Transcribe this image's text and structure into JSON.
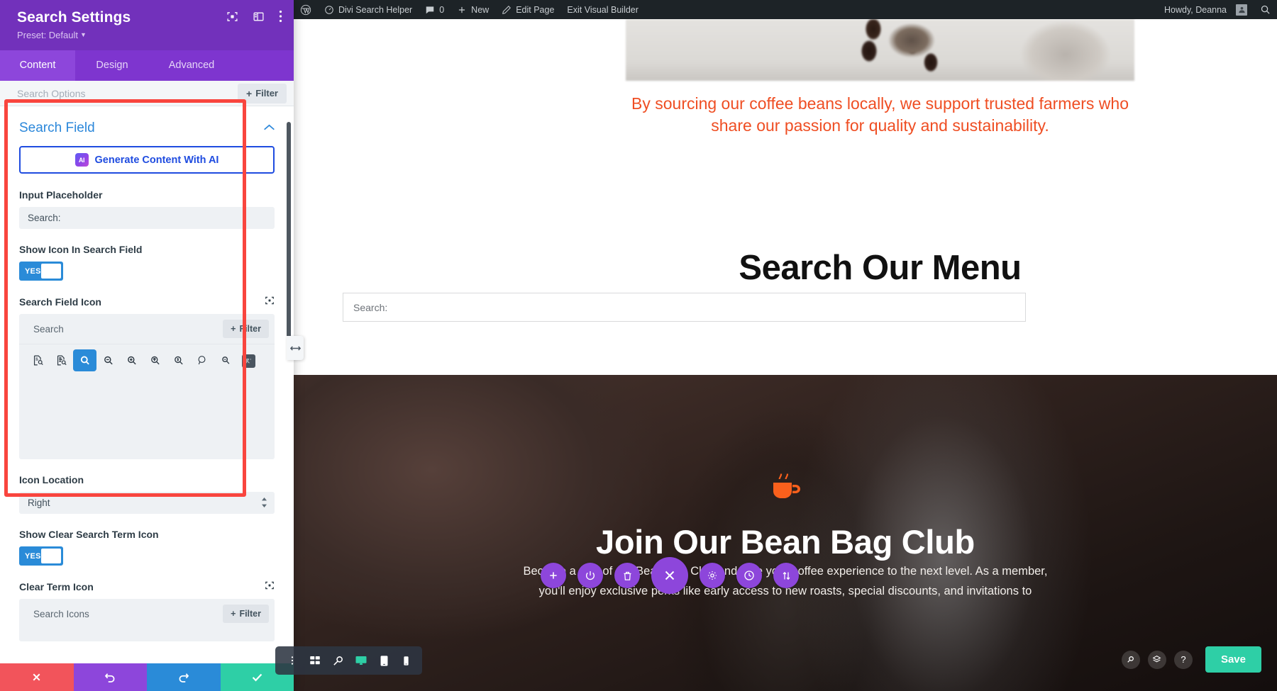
{
  "settings_panel": {
    "title": "Search Settings",
    "preset": "Preset: Default",
    "header_icons": [
      "responsive-preview-icon",
      "layout-columns-icon",
      "more-options-icon"
    ],
    "tabs": [
      {
        "label": "Content",
        "active": true
      },
      {
        "label": "Design",
        "active": false
      },
      {
        "label": "Advanced",
        "active": false
      }
    ],
    "subbar": {
      "search_label": "Search Options",
      "filter_label": "Filter"
    },
    "section": {
      "title": "Search Field",
      "collapse_icon": "chevron-up-icon",
      "ai_button_label": "Generate Content With AI",
      "ai_badge_text": "AI",
      "input_placeholder_label": "Input Placeholder",
      "input_placeholder_value": "Search:",
      "show_icon_label": "Show Icon In Search Field",
      "show_icon_toggle": "YES",
      "search_field_icon_label": "Search Field Icon",
      "icon_picker": {
        "search_placeholder": "Search",
        "filter_label": "Filter",
        "icons": [
          {
            "name": "document-search-icon",
            "selected": false
          },
          {
            "name": "file-search-icon",
            "selected": false
          },
          {
            "name": "magnifier-icon",
            "selected": true
          },
          {
            "name": "zoom-out-icon",
            "selected": false
          },
          {
            "name": "zoom-in-icon",
            "selected": false
          },
          {
            "name": "magnifier-location-icon",
            "selected": false
          },
          {
            "name": "magnifier-dollar-icon",
            "selected": false
          },
          {
            "name": "magnifier-outline-icon",
            "selected": false
          },
          {
            "name": "magnifier-small-icon",
            "selected": false
          },
          {
            "name": "raw-glyph-icon",
            "selected": false
          }
        ]
      },
      "icon_location_label": "Icon Location",
      "icon_location_value": "Right",
      "show_clear_label": "Show Clear Search Term Icon",
      "show_clear_toggle": "YES",
      "clear_term_icon_label": "Clear Term Icon",
      "clear_term_picker": {
        "search_placeholder": "Search Icons",
        "filter_label": "Filter"
      }
    },
    "footer": [
      {
        "name": "discard-button",
        "icon": "close-icon",
        "color": "#f2545b"
      },
      {
        "name": "undo-button",
        "icon": "undo-icon",
        "color": "#8d46db"
      },
      {
        "name": "redo-button",
        "icon": "redo-icon",
        "color": "#2a8bd8"
      },
      {
        "name": "apply-button",
        "icon": "check-icon",
        "color": "#2ecfa6"
      }
    ]
  },
  "admin_bar": {
    "items": [
      {
        "name": "wordpress-logo",
        "label": ""
      },
      {
        "name": "site-name",
        "label": "Divi Search Helper"
      },
      {
        "name": "comments",
        "label": "0"
      },
      {
        "name": "new-content",
        "label": "New"
      },
      {
        "name": "edit-page",
        "label": "Edit Page"
      },
      {
        "name": "exit-visual-builder",
        "label": "Exit Visual Builder"
      }
    ],
    "howdy": "Howdy, Deanna",
    "search_icon": "search-icon"
  },
  "preview": {
    "orange_copy": "By sourcing our coffee beans locally, we support trusted farmers who share our passion for quality and sustainability.",
    "menu_heading": "Search Our Menu",
    "search_placeholder": "Search:",
    "club_heading": "Join Our Bean Bag Club",
    "club_copy": "Become a part of our Bean Bag Club and take your coffee experience to the next level. As a member, you'll enjoy exclusive perks like early access to new roasts, special discounts, and invitations to",
    "cup_icon": "coffee-cup-icon"
  },
  "divi_toolbar": {
    "items": [
      {
        "name": "more-vertical-icon",
        "active": false
      },
      {
        "name": "wireframe-view-icon",
        "active": false
      },
      {
        "name": "zoom-out-view-icon",
        "active": false
      },
      {
        "name": "desktop-view-icon",
        "active": true
      },
      {
        "name": "tablet-view-icon",
        "active": false
      },
      {
        "name": "phone-view-icon",
        "active": false
      }
    ]
  },
  "divi_circles": [
    {
      "name": "add-module-button",
      "icon": "plus-icon",
      "size": "small"
    },
    {
      "name": "power-button",
      "icon": "power-icon",
      "size": "small"
    },
    {
      "name": "delete-button",
      "icon": "trash-icon",
      "size": "small"
    },
    {
      "name": "close-builder-button",
      "icon": "close-icon",
      "size": "big"
    },
    {
      "name": "settings-button",
      "icon": "gear-icon",
      "size": "small"
    },
    {
      "name": "history-button",
      "icon": "clock-icon",
      "size": "small"
    },
    {
      "name": "sort-button",
      "icon": "sort-icon",
      "size": "small"
    }
  ],
  "divi_right": {
    "icons": [
      {
        "name": "search-icon",
        "glyph": "⚲"
      },
      {
        "name": "layers-icon",
        "glyph": "◈"
      },
      {
        "name": "help-icon",
        "glyph": "?"
      }
    ],
    "save_label": "Save"
  },
  "colors": {
    "panel_header": "#7231bb",
    "panel_tabs": "#7e35cf",
    "accent_blue": "#2a8bd8",
    "section_title": "#2b87da",
    "highlight_red": "#f9453e",
    "save_green": "#2ecfa6",
    "orange_text": "#ef4e23",
    "ai_blue": "#1f4ce0"
  }
}
